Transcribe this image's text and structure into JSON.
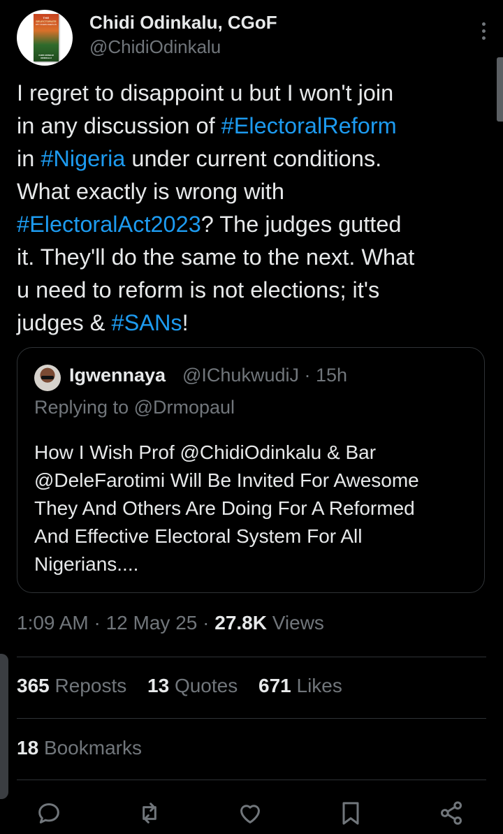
{
  "author": {
    "name": "Chidi Odinkalu, CGoF",
    "handle": "@ChidiOdinkalu",
    "avatar_book": {
      "title_top": "THE",
      "title": "SELECTORATE",
      "subtitle": "WHY NIGERIA NEEDS AN",
      "author": "CHIDI ANSELM ODINKALU"
    }
  },
  "tweet": {
    "t1": "I regret to disappoint u but I won't join\nin any discussion of ",
    "h1": "#ElectoralReform",
    "t2": "\nin ",
    "h2": "#Nigeria",
    "t3": " under current conditions.\nWhat exactly is wrong with\n",
    "h3": "#ElectoralAct2023",
    "t4": "? The judges gutted\nit. They'll do the same to the next. What\nu need to reform is not elections; it's\njudges & ",
    "h4": "#SANs",
    "t5": "!"
  },
  "quote": {
    "name": "Igwennaya",
    "handle_time": "@IChukwudiJ · 15h",
    "replying": "Replying to @Drmopaul",
    "text": "How I Wish Prof @ChidiOdinkalu &  Bar\n@DeleFarotimi Will Be Invited For Awesome\nThey And Others Are Doing For A Reformed\nAnd Effective Electoral System For All\nNigerians...."
  },
  "meta": {
    "time_date": "1:09 AM · 12 May 25 · ",
    "views_count": "27.8K",
    "views_label": " Views"
  },
  "stats": {
    "reposts_count": "365",
    "reposts_label": "Reposts",
    "quotes_count": "13",
    "quotes_label": "Quotes",
    "likes_count": "671",
    "likes_label": "Likes",
    "bookmarks_count": "18",
    "bookmarks_label": "Bookmarks"
  },
  "icons": {
    "reply": "reply-icon",
    "repost": "repost-icon",
    "like": "heart-icon",
    "bookmark": "bookmark-icon",
    "share": "share-icon",
    "more": "more-icon"
  },
  "colors": {
    "background": "#000000",
    "text": "#e7e9ea",
    "muted": "#71767b",
    "hashtag": "#1d9bf0",
    "border": "#2f3336"
  }
}
